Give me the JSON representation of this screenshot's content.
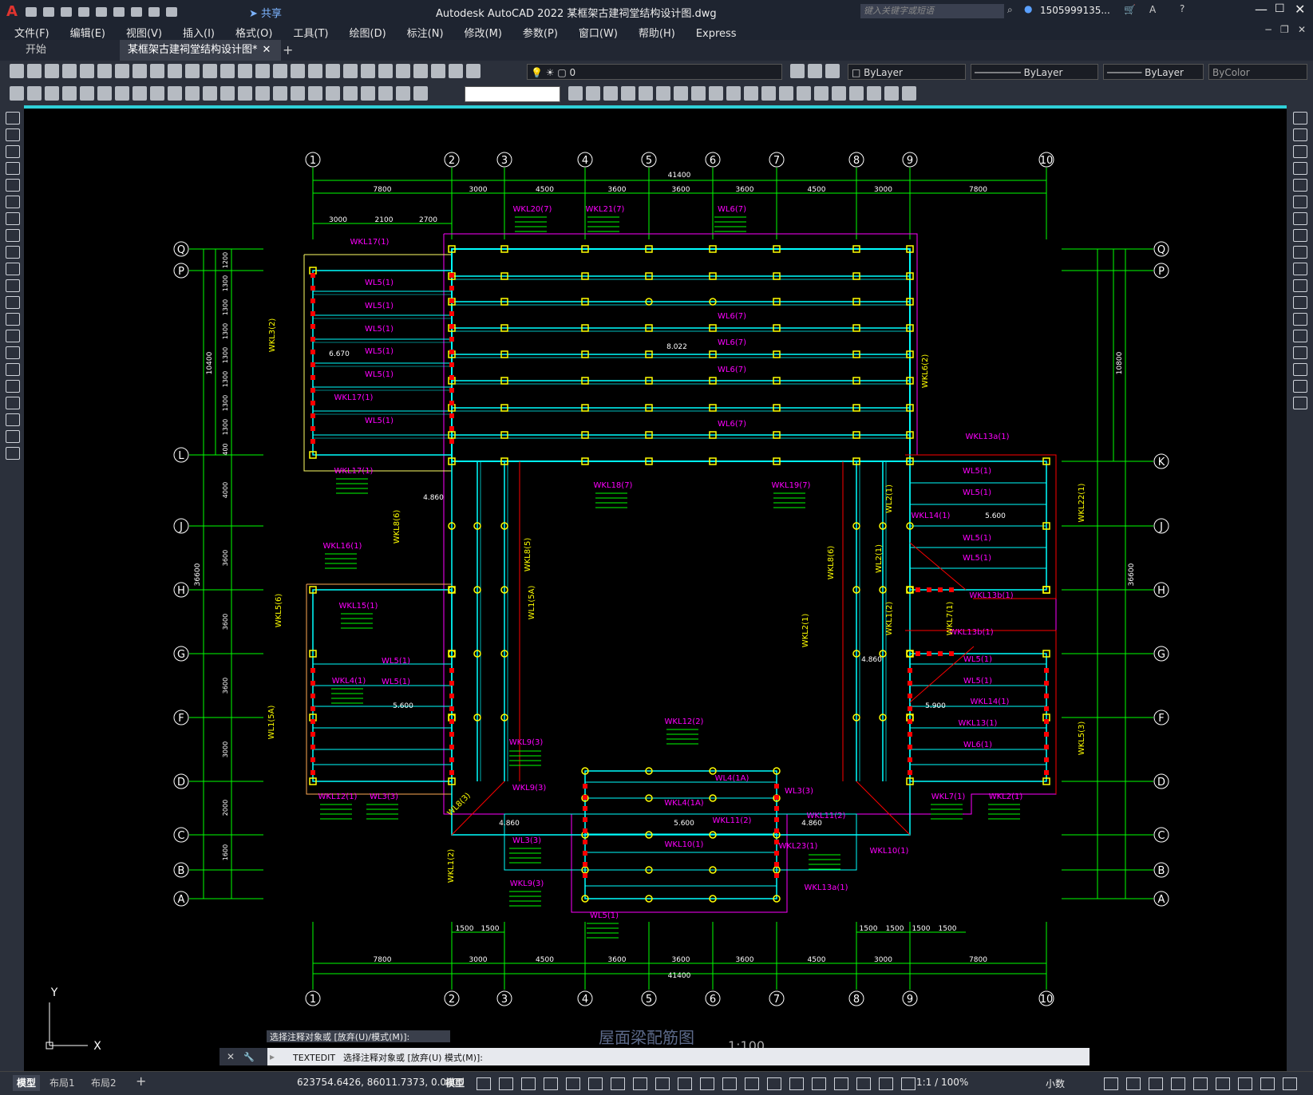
{
  "app": {
    "title": "Autodesk AutoCAD 2022    某框架古建祠堂结构设计图.dwg",
    "search_placeholder": "键入关键字或短语",
    "user": "1505999135...",
    "share": "共享",
    "logo": "A"
  },
  "menu": [
    "文件(F)",
    "编辑(E)",
    "视图(V)",
    "插入(I)",
    "格式(O)",
    "工具(T)",
    "绘图(D)",
    "标注(N)",
    "修改(M)",
    "参数(P)",
    "窗口(W)",
    "帮助(H)",
    "Express"
  ],
  "tabs": [
    {
      "label": "开始"
    },
    {
      "label": "某框架古建祠堂结构设计图*"
    }
  ],
  "toolbar": {
    "layer_value": "0",
    "color": "ByLayer",
    "linetype": "ByLayer",
    "lineweight": "ByLayer",
    "plotstyle": "ByColor"
  },
  "drawing": {
    "title": "屋面梁配筋图",
    "scale": "1:100",
    "total_width": "41400",
    "col_dims": [
      "7800",
      "3000",
      "4500",
      "3600",
      "3600",
      "3600",
      "4500",
      "3000",
      "7800"
    ],
    "col_labels": [
      "1",
      "2",
      "3",
      "4",
      "5",
      "6",
      "7",
      "8",
      "9",
      "10"
    ],
    "row_labels_left": [
      "Q",
      "P",
      "L",
      "J",
      "H",
      "G",
      "F",
      "D",
      "C",
      "B",
      "A"
    ],
    "row_labels_right": [
      "Q",
      "P",
      "K",
      "J",
      "H",
      "G",
      "F",
      "D",
      "C",
      "B",
      "A"
    ],
    "top_sub_dims": [
      "3000",
      "2100",
      "2700"
    ],
    "bottom_sub_dims_left": [
      "1500",
      "1500"
    ],
    "bottom_sub_dims_right": [
      "1500",
      "1500",
      "1500",
      "1500"
    ],
    "left_row_dims": [
      "1200",
      "1300",
      "1300",
      "1300",
      "1300",
      "1300",
      "1300",
      "1300",
      "400",
      "4000",
      "3600",
      "3600",
      "3600",
      "3000",
      "2000",
      "1600"
    ],
    "left_total_upper": "10400",
    "left_total": "36600",
    "right_total": "36600",
    "right_total_upper": "10800",
    "elevations": [
      "6.670",
      "8.022",
      "4.860",
      "5.600",
      "5.600",
      "4.860",
      "5.900",
      "4.860",
      "5.600",
      "4.860"
    ],
    "beam_labels": [
      "WKL20(7)",
      "WKL21(7)",
      "WL6(7)",
      "WKL17(1)",
      "WL5(1)",
      "WL5(1)",
      "WL5(1)",
      "WL5(1)",
      "WL5(1)",
      "WKL17(1)",
      "WL5(1)",
      "WL6(7)",
      "WL6(7)",
      "WL6(7)",
      "WL6(7)",
      "WKL3(2)",
      "WKL6(2)",
      "WKL13a(1)",
      "WKL17(1)",
      "WKL18(7)",
      "WKL19(7)",
      "WKL16(1)",
      "WL5(1)",
      "WL5(1)",
      "WKL14(1)",
      "WL5(1)",
      "WL5(1)",
      "WKL15(1)",
      "WKL13b(1)",
      "WKL13b(1)",
      "WKL4(1)",
      "WL5(1)",
      "WL5(1)",
      "WKL14(1)",
      "WL5(1)",
      "WL5(1)",
      "WKL13(1)",
      "WL6(1)",
      "WKL12(1)",
      "WL3(3)",
      "WKL9(3)",
      "WKL12(2)",
      "WL4(1A)",
      "WL3(3)",
      "WKL9(3)",
      "WKL4(1A)",
      "WKL11(2)",
      "WKL11(2)",
      "WL3(3)",
      "WKL23(1)",
      "WKL10(1)",
      "WKL10(1)",
      "WKL9(3)",
      "WKL13a(1)",
      "WL5(1)",
      "WKL7(1)",
      "WKL2(1)",
      "WKL1(2)",
      "WKL5(6)",
      "WL1(5A)",
      "WKL8(6)",
      "WKL8(5)",
      "WL1(5A)",
      "WKL8(6)",
      "WL2(1)",
      "WKL1(2)",
      "WKL2(1)",
      "WL2(1)",
      "WKL22(1)",
      "WKL5(3)",
      "WKL7(1)",
      "WL8(3)"
    ]
  },
  "command": {
    "history": "选择注释对象或 [放弃(U)/模式(M)]:",
    "prompt_cmd": "TEXTEDIT",
    "prompt_text": "选择注释对象或 [放弃(U) 模式(M)]:"
  },
  "layout_tabs": [
    "模型",
    "布局1",
    "布局2"
  ],
  "status": {
    "coords": "623754.6426, 86011.7373, 0.0000",
    "space": "模型",
    "scale": "1:1 / 100%",
    "units": "小数"
  },
  "ucs": {
    "x": "X",
    "y": "Y"
  },
  "colors": {
    "grid": "#00ff00",
    "beam": "#00ffff",
    "label": "#ff00ff",
    "column": "#ffff00",
    "axis_circle": "#ffffff",
    "red": "#ff0000"
  }
}
